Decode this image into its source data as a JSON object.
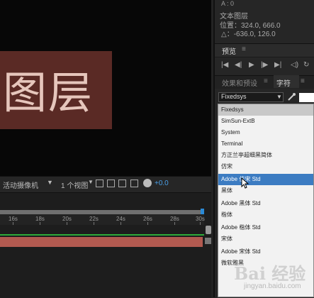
{
  "viewer": {
    "layer_text": "图层",
    "camera": "活动摄像机",
    "view_count": "1 个视图",
    "exposure_value": "+0.0"
  },
  "timeline": {
    "ticks": [
      "16s",
      "18s",
      "20s",
      "22s",
      "24s",
      "26s",
      "28s",
      "30s"
    ]
  },
  "info": {
    "a_value": "A : 0",
    "layer_name": "文本图层",
    "position": "位置：324.0, 666.0",
    "delta": "△：-636.0, 126.0"
  },
  "preview": {
    "title": "预览",
    "menu": "≡",
    "controls": [
      "|◀",
      "◀|",
      "▶",
      "|▶",
      "▶|"
    ]
  },
  "tabs": {
    "effects": "效果和预设",
    "effects_menu": "≡",
    "character": "字符",
    "character_menu": "≡"
  },
  "character": {
    "font_value": "Fixedsys",
    "font_list": [
      "Fixedsys",
      "SimSun-ExtB",
      "System",
      "Terminal",
      "方正兰亭超细黑简体",
      "仿宋",
      "Adobe 仿宋 Std",
      "黑体",
      "Adobe 黑体 Std",
      "楷体",
      "Adobe 楷体 Std",
      "宋体",
      "Adobe 宋体 Std",
      "微软雅黑"
    ],
    "selected_index": 6,
    "swatch_color": "#ffffff"
  },
  "watermark": {
    "logo": "Bai 经验",
    "url": "jingyan.baidu.com"
  }
}
